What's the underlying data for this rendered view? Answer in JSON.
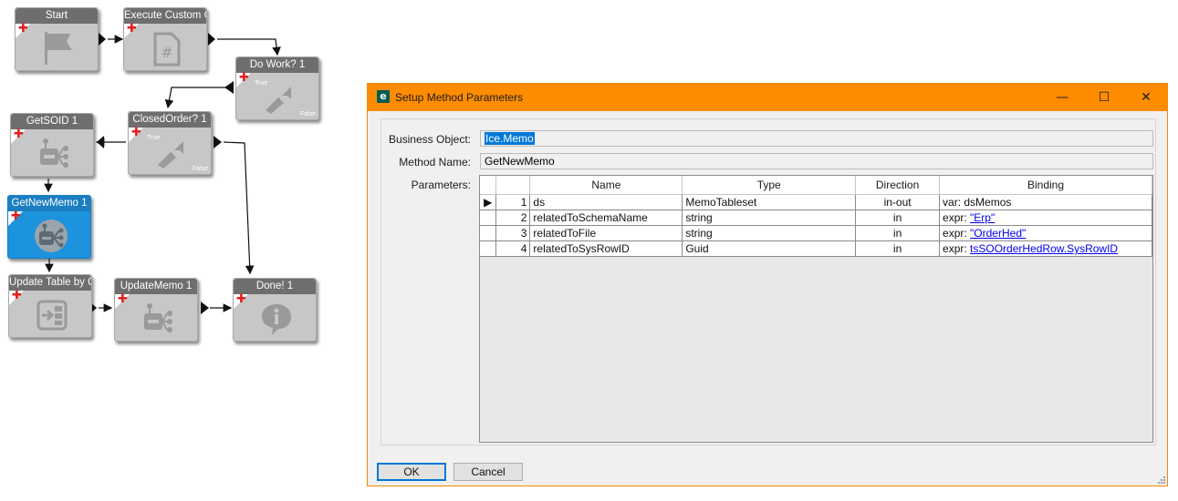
{
  "workflow": {
    "nodes": {
      "start": {
        "title": "Start"
      },
      "execute_custom": {
        "title": "Execute Custom Co"
      },
      "do_work": {
        "title": "Do Work? 1",
        "true_label": "True",
        "false_label": "False"
      },
      "closed_order": {
        "title": "ClosedOrder? 1",
        "true_label": "True",
        "false_label": "False"
      },
      "get_soid": {
        "title": "GetSOID 1"
      },
      "get_new_memo": {
        "title": "GetNewMemo 1"
      },
      "update_table": {
        "title": "Update Table by Q"
      },
      "update_memo": {
        "title": "UpdateMemo 1"
      },
      "done": {
        "title": "Done! 1"
      }
    }
  },
  "dialog": {
    "icon_letter": "e",
    "title": "Setup Method Parameters",
    "controls": {
      "minimize": "—",
      "maximize": "☐",
      "close": "✕"
    },
    "business_object_label": "Business Object:",
    "business_object_value": "Ice.Memo",
    "method_name_label": "Method Name:",
    "method_name_value": "GetNewMemo",
    "parameters_label": "Parameters:",
    "grid": {
      "headers": {
        "name": "Name",
        "type": "Type",
        "direction": "Direction",
        "binding": "Binding"
      },
      "rows": [
        {
          "num": "1",
          "name": "ds",
          "type": "MemoTableset",
          "direction": "in-out",
          "binding_prefix": "var: ",
          "binding_value": "dsMemos",
          "current": "▶"
        },
        {
          "num": "2",
          "name": "relatedToSchemaName",
          "type": "string",
          "direction": "in",
          "binding_prefix": "expr: ",
          "binding_value": "\"Erp\"",
          "current": ""
        },
        {
          "num": "3",
          "name": "relatedToFile",
          "type": "string",
          "direction": "in",
          "binding_prefix": "expr: ",
          "binding_value": "\"OrderHed\"",
          "current": ""
        },
        {
          "num": "4",
          "name": "relatedToSysRowID",
          "type": "Guid",
          "direction": "in",
          "binding_prefix": "expr: ",
          "binding_value": "tsSOOrderHedRow.SysRowID",
          "current": ""
        }
      ]
    },
    "ok_label": "OK",
    "cancel_label": "Cancel"
  },
  "colors": {
    "titlebar": "#ff8c00",
    "node_body": "#c7c7c7",
    "node_header": "#6e6e6e",
    "node_selected": "#1d93de",
    "link": "#0000ee"
  }
}
